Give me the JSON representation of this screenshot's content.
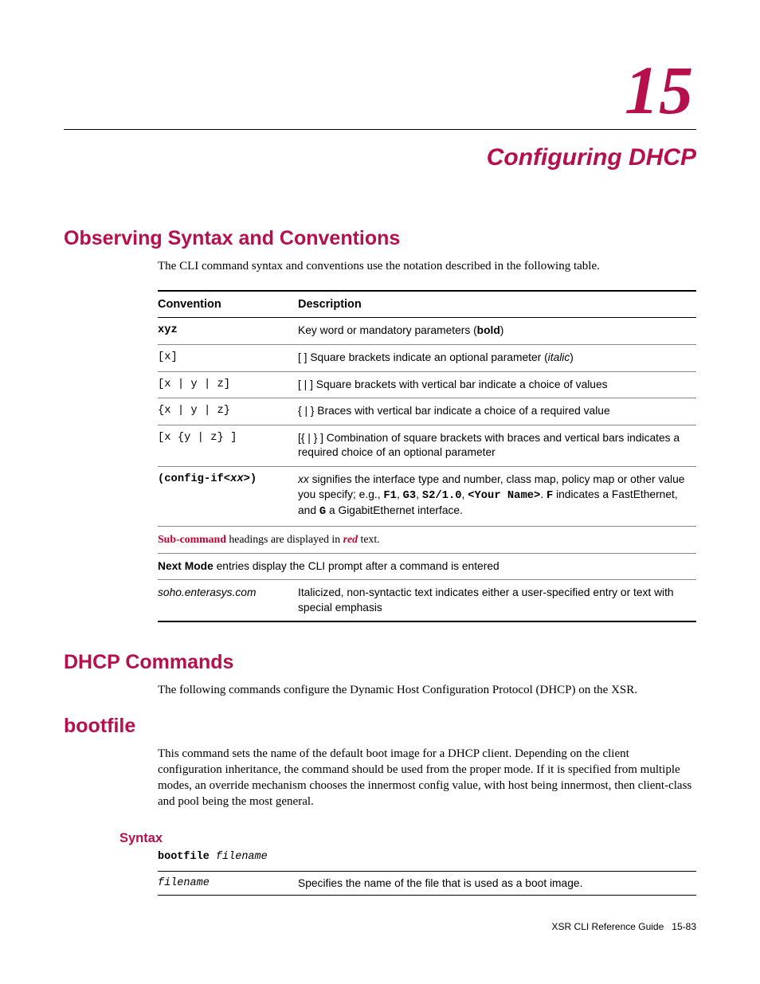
{
  "chapter": {
    "number": "15",
    "title": "Configuring DHCP"
  },
  "sec1": {
    "heading": "Observing Syntax and Conventions",
    "intro": "The CLI command syntax and conventions use the notation described in the following table."
  },
  "convTable": {
    "headers": {
      "c1": "Convention",
      "c2": "Description"
    },
    "rows": {
      "r0": {
        "c1": "xyz",
        "c2_pre": "Key word or mandatory parameters (",
        "c2_bold": "bold",
        "c2_post": ")"
      },
      "r1": {
        "c1": "[x]",
        "c2_pre": "[ ] Square brackets indicate an optional parameter (",
        "c2_ital": "italic",
        "c2_post": ")"
      },
      "r2": {
        "c1": "[x | y | z]",
        "c2": "[ | ] Square brackets with vertical bar indicate a choice of values"
      },
      "r3": {
        "c1": "{x | y | z}",
        "c2": "{ | } Braces with vertical bar indicate a choice of a required value"
      },
      "r4": {
        "c1": "[x {y | z} ]",
        "c2": "[{ | } ] Combination of square brackets with braces and vertical bars indicates a required choice of an optional parameter"
      },
      "r5": {
        "c1_pre": "(config-if<",
        "c1_ital": "xx",
        "c1_post": ">)",
        "c2_a": "xx",
        "c2_b": " signifies the interface type and number, class map, policy map or other value you specify; e.g., ",
        "c2_c": "F1",
        "c2_d": ", ",
        "c2_e": "G3",
        "c2_f": ", ",
        "c2_g": "S2/1.0",
        "c2_h": ", ",
        "c2_i": "<Your Name>",
        "c2_j": ". ",
        "c2_k": "F",
        "c2_l": " indicates a FastEthernet, and ",
        "c2_m": "G",
        "c2_n": " a GigabitEthernet interface."
      },
      "r6": {
        "a": "Sub-command",
        "b": " headings are displayed in ",
        "c": "red",
        "d": " text."
      },
      "r7": {
        "a": "Next Mode",
        "b": " entries display the CLI prompt after a command is entered"
      },
      "r8": {
        "c1": "soho.enterasys.com",
        "c2": "Italicized, non-syntactic text indicates either a user-specified entry or text with special emphasis"
      }
    }
  },
  "sec2": {
    "heading": "DHCP Commands",
    "intro": "The following commands configure the Dynamic Host Configuration Protocol (DHCP) on the XSR."
  },
  "sec3": {
    "heading": "bootfile",
    "intro": "This command sets the name of the default boot image for a DHCP client. Depending on the client configuration inheritance, the command should be used from the proper mode. If it is specified from multiple modes, an override mechanism chooses the innermost config value, with host being innermost, then client-class and pool being the most general.",
    "syntaxHeading": "Syntax",
    "cmd": {
      "kw": "bootfile",
      "var": "filename"
    },
    "table": {
      "r0": {
        "c1": "filename",
        "c2": "Specifies the name of the file that is used as a boot image."
      }
    }
  },
  "footer": {
    "left": "XSR CLI Reference Guide",
    "right": "15-83"
  }
}
